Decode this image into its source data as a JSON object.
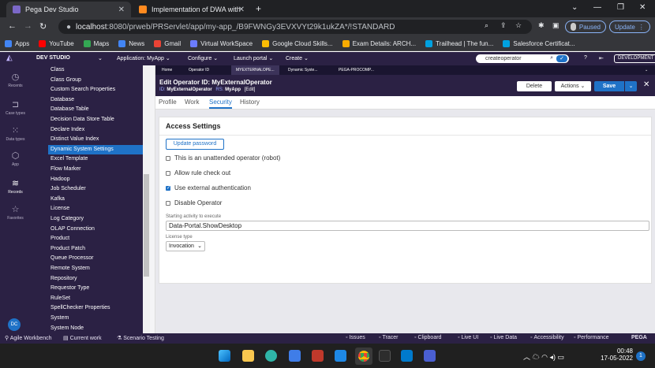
{
  "browser": {
    "tabs": [
      {
        "title": "Pega Dev Studio",
        "active": true
      },
      {
        "title": "Implementation of DWA with a s",
        "active": false
      }
    ],
    "new_tab": "+",
    "url_host": "localhost",
    "url_rest": ":8080/prweb/PRServlet/app/my-app_/B9FWNGy3EVXVYt29k1ukZA*/!STANDARD",
    "paused_label": "Paused",
    "update_label": "Update",
    "bookmarks": [
      {
        "label": "Apps",
        "color": "#4285f4"
      },
      {
        "label": "YouTube",
        "color": "#ff0000"
      },
      {
        "label": "Maps",
        "color": "#34a853"
      },
      {
        "label": "News",
        "color": "#4285f4"
      },
      {
        "label": "Gmail",
        "color": "#ea4335"
      },
      {
        "label": "Virtual WorkSpace",
        "color": "#6b7cff"
      },
      {
        "label": "Google Cloud Skills...",
        "color": "#fbbc04"
      },
      {
        "label": "Exam Details: ARCH...",
        "color": "#f9ab00"
      },
      {
        "label": "Trailhead | The fun...",
        "color": "#00a1e0"
      },
      {
        "label": "Salesforce Certificat...",
        "color": "#00a1e0"
      }
    ]
  },
  "pega": {
    "studio": "DEV STUDIO",
    "application_label": "Application:",
    "application_value": "MyApp",
    "configure": "Configure",
    "launch_portal": "Launch portal",
    "create": "Create",
    "search_value": "createoperator",
    "development_badge": "DEVELOPMENT",
    "work_tabs": [
      "Home",
      "Operator ID",
      "MYEXTERNALOPE...",
      "Dynamic Syste...",
      "PEGA-PROCOMP..."
    ],
    "rail": [
      {
        "label": "Recents",
        "icon": "clock-icon"
      },
      {
        "label": "Case types",
        "icon": "case-icon"
      },
      {
        "label": "Data types",
        "icon": "grid-icon"
      },
      {
        "label": "App",
        "icon": "cube-icon"
      },
      {
        "label": "Records",
        "icon": "stack-icon"
      },
      {
        "label": "Favorites",
        "icon": "star-icon"
      }
    ],
    "avatar_initials": "DC",
    "records": [
      "Class",
      "Class Group",
      "Custom Search Properties",
      "Database",
      "Database Table",
      "Decision Data Store Table",
      "Declare Index",
      "Distinct Value Index",
      "Dynamic System Settings",
      "Excel Template",
      "Flow Marker",
      "Hadoop",
      "Job Scheduler",
      "Kafka",
      "License",
      "Log Category",
      "OLAP Connection",
      "Product",
      "Product Patch",
      "Queue Processor",
      "Remote System",
      "Repository",
      "Requestor Type",
      "RuleSet",
      "SpellChecker Properties",
      "System",
      "System Node"
    ],
    "selected_record": "Dynamic System Settings",
    "editor": {
      "title": "Edit  Operator ID: MyExternalOperator",
      "id_label": "ID:",
      "id_value": "MyExternalOperator",
      "rs_label": "RS:",
      "rs_value": "MyApp",
      "edit_link": "[Edit]",
      "delete": "Delete",
      "actions": "Actions",
      "save": "Save",
      "subtabs": [
        "Profile",
        "Work",
        "Security",
        "History"
      ],
      "active_subtab": "Security",
      "section_title": "Access Settings",
      "update_password": "Update password",
      "options": [
        {
          "label": "This is an unattended operator (robot)",
          "checked": false
        },
        {
          "label": "Allow rule check out",
          "checked": false
        },
        {
          "label": "Use external authentication",
          "checked": true
        },
        {
          "label": "Disable Operator",
          "checked": false
        }
      ],
      "starting_activity_label": "Starting activity to execute",
      "starting_activity_value": "Data-Portal.ShowDesktop",
      "license_type_label": "License type",
      "license_type_value": "Invocation"
    },
    "devbar": {
      "left": [
        "Agile Workbench",
        "Current work",
        "Scenario Testing"
      ],
      "right": [
        "Issues",
        "Tracer",
        "Clipboard",
        "Live UI",
        "Live Data",
        "Accessibility",
        "Performance"
      ],
      "brand": "PEGA"
    }
  },
  "taskbar": {
    "time": "00:48",
    "date": "17-05-2022",
    "notification_count": "1"
  }
}
